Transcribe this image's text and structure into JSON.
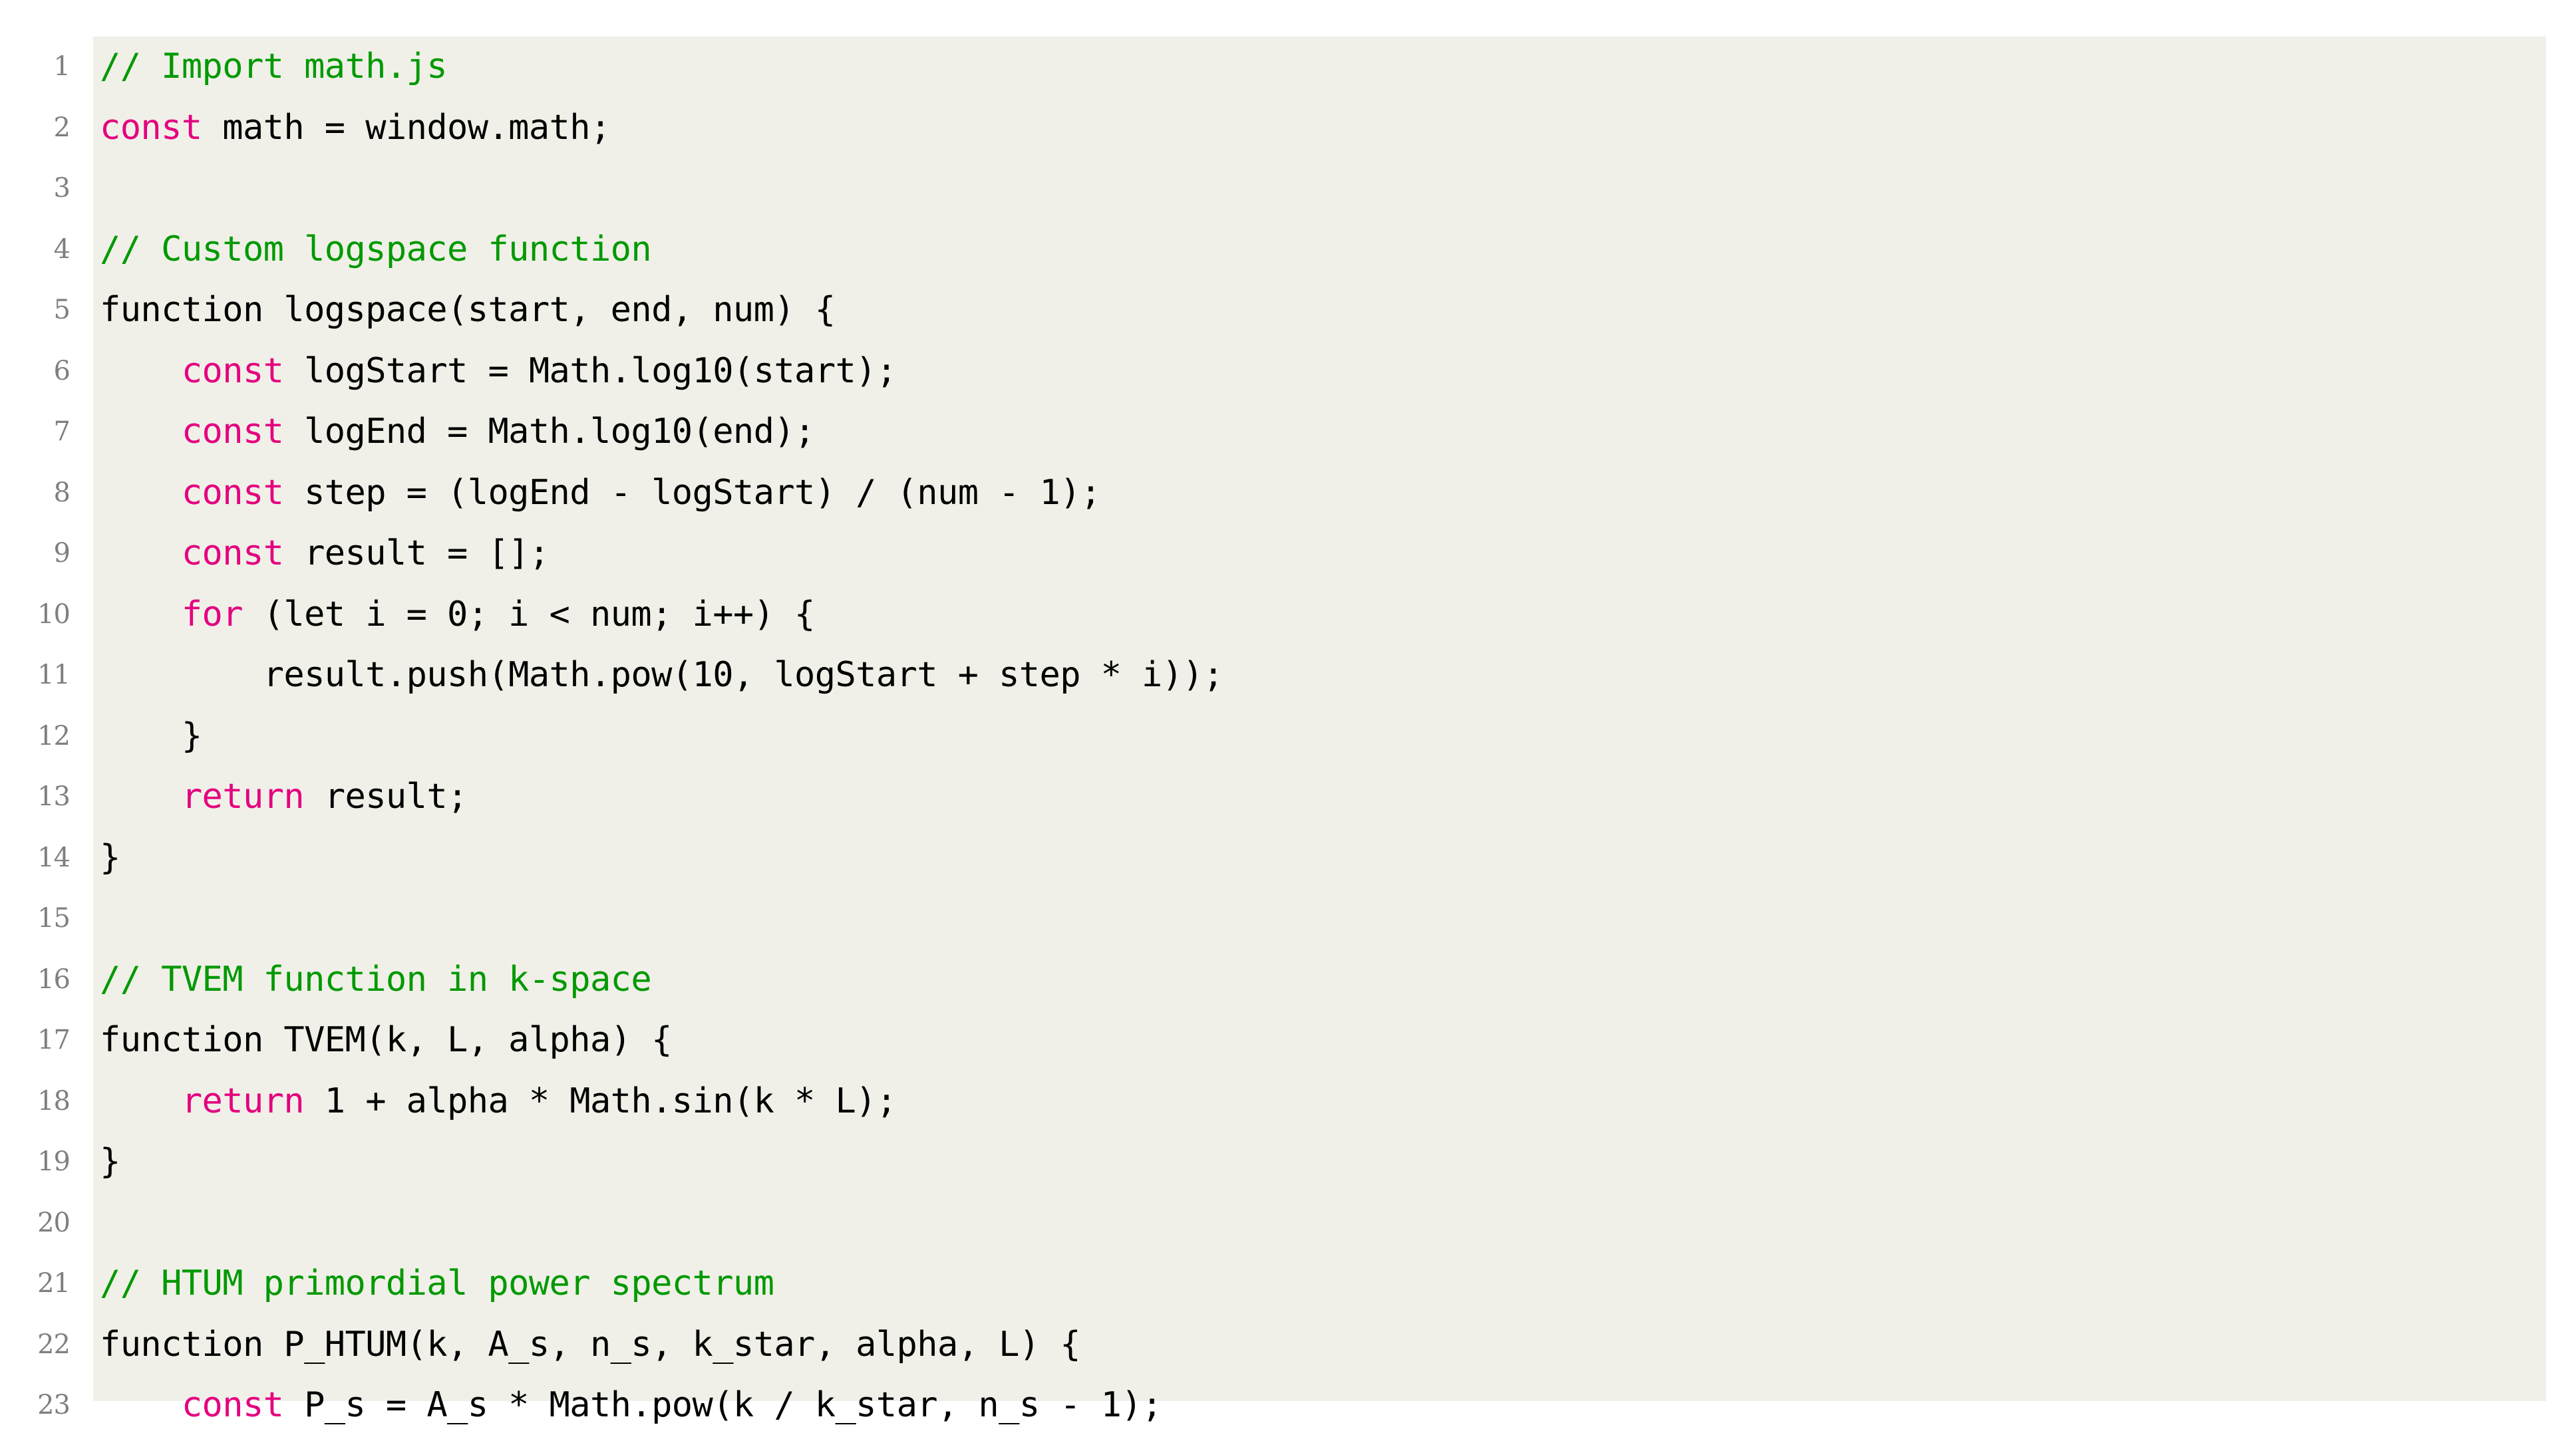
{
  "listing": {
    "language": "JavaScript",
    "style": "latex-listings",
    "colors": {
      "background": "#f0f0e8",
      "page": "#ffffff",
      "keyword": "#e4007f",
      "comment": "#009900",
      "text": "#000000",
      "line_number": "#7f7f7f"
    },
    "first_line_number": 1,
    "last_line_number": 23,
    "lines": [
      {
        "n": "1",
        "tokens": [
          {
            "t": "// Import math.js",
            "c": "comment"
          }
        ]
      },
      {
        "n": "2",
        "tokens": [
          {
            "t": "const",
            "c": "kw"
          },
          {
            "t": " math = window.math;",
            "c": "plain"
          }
        ]
      },
      {
        "n": "3",
        "tokens": [
          {
            "t": "",
            "c": "plain"
          }
        ]
      },
      {
        "n": "4",
        "tokens": [
          {
            "t": "// Custom logspace function",
            "c": "comment"
          }
        ]
      },
      {
        "n": "5",
        "tokens": [
          {
            "t": "function logspace(start, end, num) {",
            "c": "plain"
          }
        ]
      },
      {
        "n": "6",
        "tokens": [
          {
            "t": "    ",
            "c": "plain"
          },
          {
            "t": "const",
            "c": "kw"
          },
          {
            "t": " logStart = Math.log10(start);",
            "c": "plain"
          }
        ]
      },
      {
        "n": "7",
        "tokens": [
          {
            "t": "    ",
            "c": "plain"
          },
          {
            "t": "const",
            "c": "kw"
          },
          {
            "t": " logEnd = Math.log10(end);",
            "c": "plain"
          }
        ]
      },
      {
        "n": "8",
        "tokens": [
          {
            "t": "    ",
            "c": "plain"
          },
          {
            "t": "const",
            "c": "kw"
          },
          {
            "t": " step = (logEnd - logStart) / (num - 1);",
            "c": "plain"
          }
        ]
      },
      {
        "n": "9",
        "tokens": [
          {
            "t": "    ",
            "c": "plain"
          },
          {
            "t": "const",
            "c": "kw"
          },
          {
            "t": " result = [];",
            "c": "plain"
          }
        ]
      },
      {
        "n": "10",
        "tokens": [
          {
            "t": "    ",
            "c": "plain"
          },
          {
            "t": "for",
            "c": "kw"
          },
          {
            "t": " (let i = 0; i < num; i++) {",
            "c": "plain"
          }
        ]
      },
      {
        "n": "11",
        "tokens": [
          {
            "t": "        result.push(Math.pow(10, logStart + step * i));",
            "c": "plain"
          }
        ]
      },
      {
        "n": "12",
        "tokens": [
          {
            "t": "    }",
            "c": "plain"
          }
        ]
      },
      {
        "n": "13",
        "tokens": [
          {
            "t": "    ",
            "c": "plain"
          },
          {
            "t": "return",
            "c": "kw"
          },
          {
            "t": " result;",
            "c": "plain"
          }
        ]
      },
      {
        "n": "14",
        "tokens": [
          {
            "t": "}",
            "c": "plain"
          }
        ]
      },
      {
        "n": "15",
        "tokens": [
          {
            "t": "",
            "c": "plain"
          }
        ]
      },
      {
        "n": "16",
        "tokens": [
          {
            "t": "// TVEM function in k-space",
            "c": "comment"
          }
        ]
      },
      {
        "n": "17",
        "tokens": [
          {
            "t": "function TVEM(k, L, alpha) {",
            "c": "plain"
          }
        ]
      },
      {
        "n": "18",
        "tokens": [
          {
            "t": "    ",
            "c": "plain"
          },
          {
            "t": "return",
            "c": "kw"
          },
          {
            "t": " 1 + alpha * Math.sin(k * L);",
            "c": "plain"
          }
        ]
      },
      {
        "n": "19",
        "tokens": [
          {
            "t": "}",
            "c": "plain"
          }
        ]
      },
      {
        "n": "20",
        "tokens": [
          {
            "t": "",
            "c": "plain"
          }
        ]
      },
      {
        "n": "21",
        "tokens": [
          {
            "t": "// HTUM primordial power spectrum",
            "c": "comment"
          }
        ]
      },
      {
        "n": "22",
        "tokens": [
          {
            "t": "function P_HTUM(k, A_s, n_s, k_star, alpha, L) {",
            "c": "plain"
          }
        ]
      },
      {
        "n": "23",
        "tokens": [
          {
            "t": "    ",
            "c": "plain"
          },
          {
            "t": "const",
            "c": "kw"
          },
          {
            "t": " P_s = A_s * Math.pow(k / k_star, n_s - 1);",
            "c": "plain"
          }
        ]
      }
    ]
  }
}
